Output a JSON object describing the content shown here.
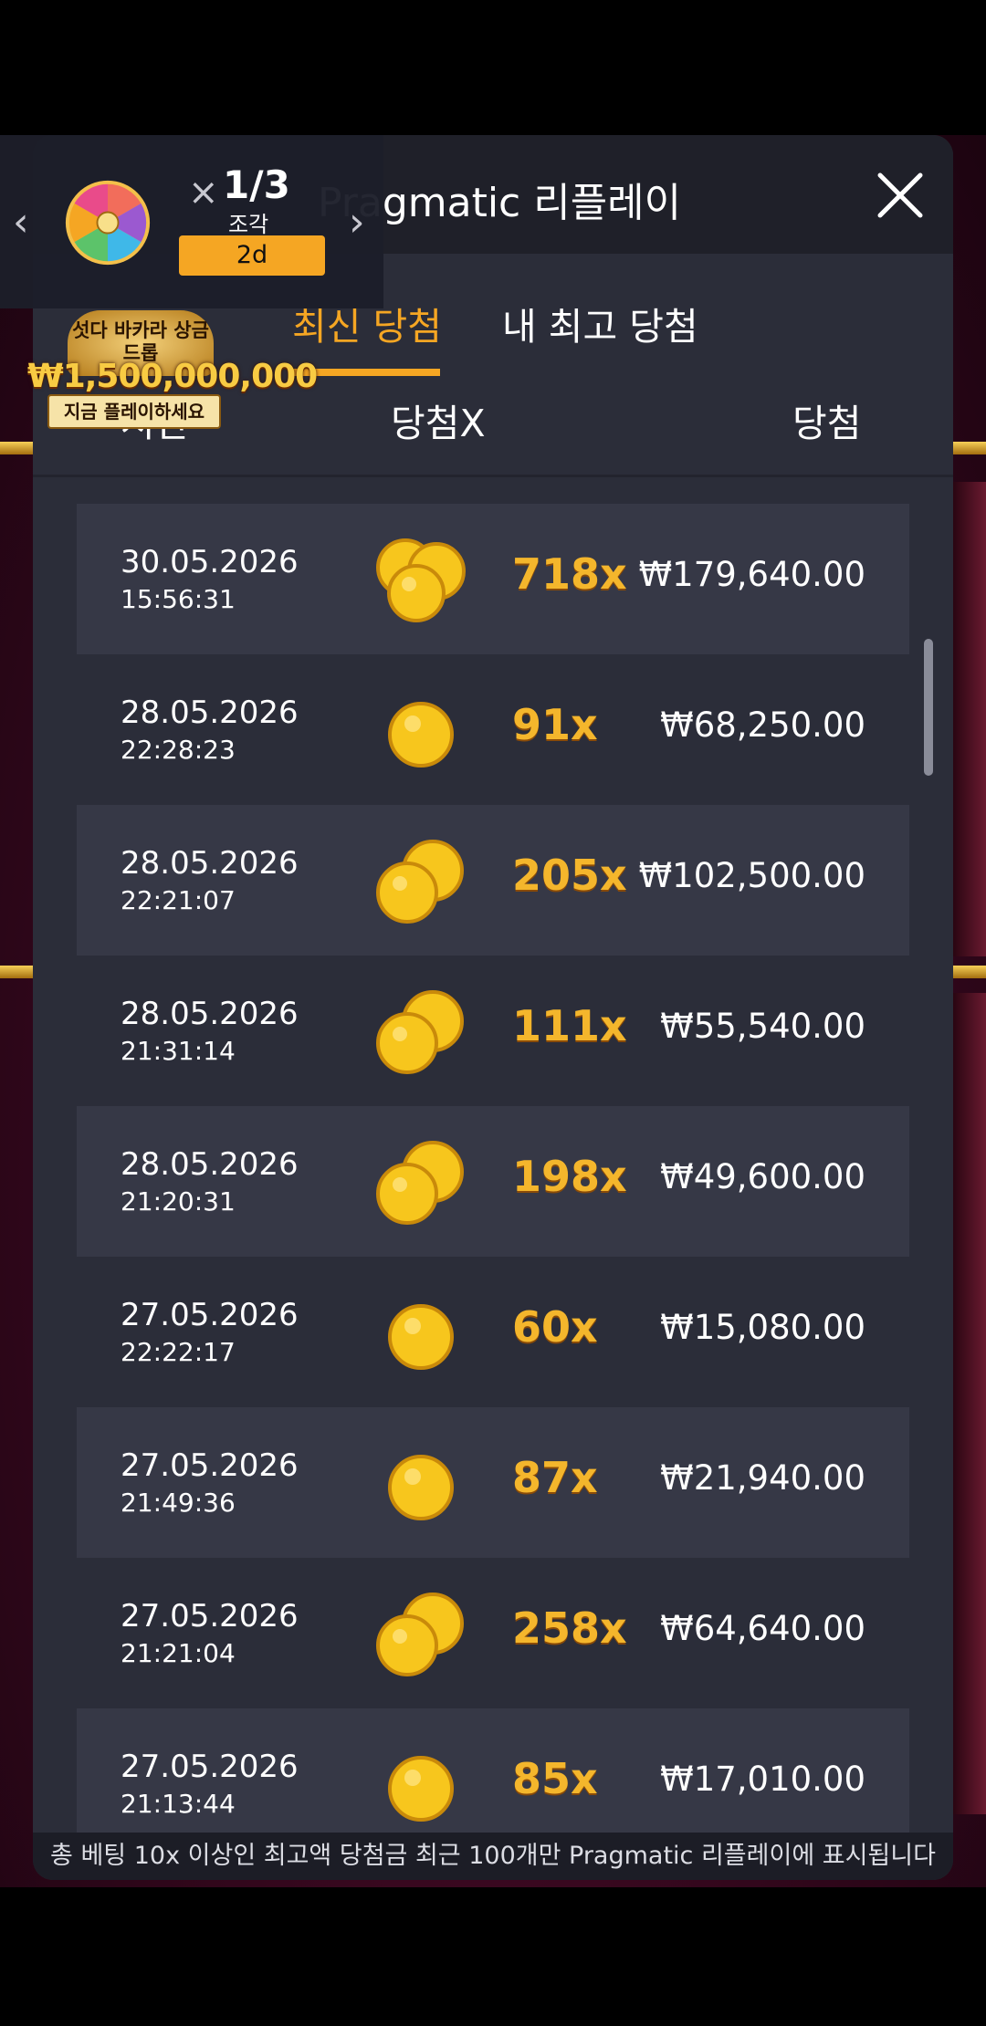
{
  "modal": {
    "title": "Pragmatic 리플레이",
    "tabs": [
      {
        "label": "최신 당첨",
        "active": true
      },
      {
        "label": "내 최고 당첨",
        "active": false
      }
    ],
    "columns": {
      "time": "시간",
      "multiplier": "당첨X",
      "win": "당첨"
    },
    "rows": [
      {
        "date": "30.05.2026",
        "time": "15:56:31",
        "coins": 3,
        "multiplier": "718x",
        "amount": "₩179,640.00"
      },
      {
        "date": "28.05.2026",
        "time": "22:28:23",
        "coins": 1,
        "multiplier": "91x",
        "amount": "₩68,250.00"
      },
      {
        "date": "28.05.2026",
        "time": "22:21:07",
        "coins": 2,
        "multiplier": "205x",
        "amount": "₩102,500.00"
      },
      {
        "date": "28.05.2026",
        "time": "21:31:14",
        "coins": 2,
        "multiplier": "111x",
        "amount": "₩55,540.00"
      },
      {
        "date": "28.05.2026",
        "time": "21:20:31",
        "coins": 2,
        "multiplier": "198x",
        "amount": "₩49,600.00"
      },
      {
        "date": "27.05.2026",
        "time": "22:22:17",
        "coins": 1,
        "multiplier": "60x",
        "amount": "₩15,080.00"
      },
      {
        "date": "27.05.2026",
        "time": "21:49:36",
        "coins": 1,
        "multiplier": "87x",
        "amount": "₩21,940.00"
      },
      {
        "date": "27.05.2026",
        "time": "21:21:04",
        "coins": 2,
        "multiplier": "258x",
        "amount": "₩64,640.00"
      },
      {
        "date": "27.05.2026",
        "time": "21:13:44",
        "coins": 1,
        "multiplier": "85x",
        "amount": "₩17,010.00"
      }
    ],
    "footer": "총 베팅 10x 이상인 최고액 당첨금 최근 100개만 Pragmatic 리플레이에 표시됩니다"
  },
  "promo": {
    "count": "1/3",
    "count_label": "조각",
    "badge": "2d",
    "banner_title": "섯다 바카라 상금 드롭",
    "banner_amount": "₩1,500,000,000",
    "banner_cta": "지금 플레이하세요"
  },
  "colors": {
    "accent": "#f5a623",
    "panel": "#2b2d39",
    "row_alt": "#363846",
    "header": "#1f2029",
    "coin": "#f7c61d"
  }
}
